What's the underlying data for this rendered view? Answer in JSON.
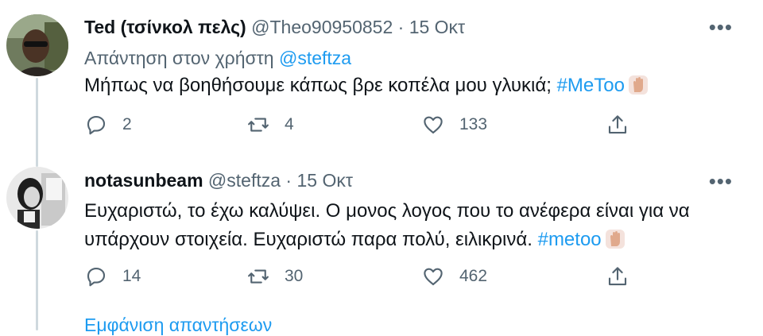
{
  "tweets": [
    {
      "name": "Ted (τσίνκολ πελς)",
      "handle": "@Theo90950852",
      "separator": "·",
      "date": "15 Οκτ",
      "more": "•••",
      "replying_prefix": "Απάντηση στον χρήστη",
      "replying_to": "@steftza",
      "text_line1": "Μήπως να βοηθήσουμε κάπως βρε κοπέλα μου γλυκιά;",
      "hashtag": "#MeToo",
      "replies": "2",
      "retweets": "4",
      "likes": "133"
    },
    {
      "name": "notasunbeam",
      "handle": "@steftza",
      "separator": "·",
      "date": "15 Οκτ",
      "more": "•••",
      "text_line1": "Ευχαριστώ, το έχω καλύψει. Ο μονος λογος που το ανέφερα είναι για να",
      "text_line2": "υπάρχουν στοιχεία. Ευχαριστώ παρα πολύ, ειλικρινά.",
      "hashtag": "#metoo",
      "replies": "14",
      "retweets": "30",
      "likes": "462"
    }
  ],
  "footer": {
    "show_replies": "Εμφάνιση απαντήσεων"
  },
  "colors": {
    "link": "#1d9bf0",
    "secondary": "#536471",
    "text": "#0f1419",
    "thread_line": "#cfd9de"
  },
  "icons": [
    "reply-icon",
    "retweet-icon",
    "like-icon",
    "share-icon",
    "raised-hand-emoji"
  ]
}
